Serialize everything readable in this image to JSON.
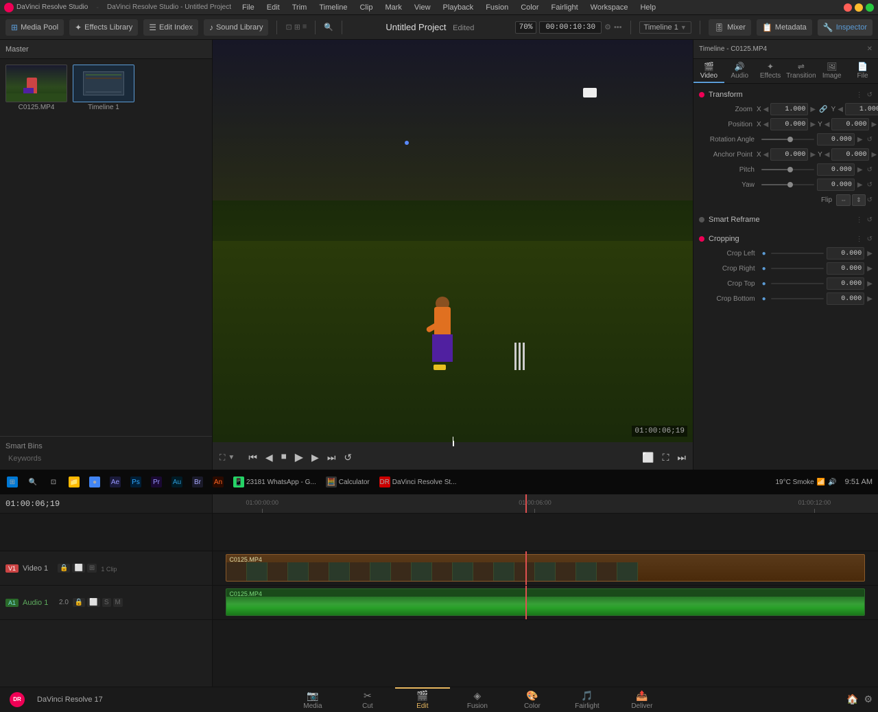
{
  "app": {
    "title": "DaVinci Resolve Studio - Untitled Project",
    "name": "DaVinci Resolve Studio",
    "project_name": "Untitled Project",
    "edited_label": "Edited"
  },
  "menu": {
    "items": [
      "DaVinci Resolve",
      "File",
      "Edit",
      "Trim",
      "Timeline",
      "Clip",
      "Mark",
      "View",
      "Playback",
      "Fusion",
      "Color",
      "Fairlight",
      "Workspace",
      "Help"
    ]
  },
  "toolbar": {
    "media_pool": "Media Pool",
    "effects_library": "Effects Library",
    "edit_index": "Edit Index",
    "sound_library": "Sound Library",
    "project_title": "Untitled Project",
    "edited": "Edited",
    "timeline_label": "Timeline 1",
    "zoom_level": "70%",
    "timecode": "00:00:10:30",
    "mixer": "Mixer",
    "metadata": "Metadata",
    "inspector": "Inspector",
    "timeline_inspector": "Timeline - C0125.MP4"
  },
  "media_panel": {
    "title": "Master",
    "clips": [
      {
        "name": "C0125.MP4",
        "type": "video"
      },
      {
        "name": "Timeline 1",
        "type": "timeline"
      }
    ]
  },
  "smart_bins": {
    "title": "Smart Bins",
    "keywords": "Keywords"
  },
  "preview": {
    "timecode": "01:00:06;19"
  },
  "inspector": {
    "title": "Timeline - C0125.MP4",
    "tabs": [
      "Video",
      "Audio",
      "Effects",
      "Transition",
      "Image",
      "File"
    ],
    "sections": {
      "transform": {
        "label": "Transform",
        "zoom": {
          "x": "1.000",
          "y": "1.000"
        },
        "position": {
          "x": "0.000",
          "y": "0.000"
        },
        "rotation_angle": "0.000",
        "anchor_point": {
          "x": "0.000",
          "y": "0.000"
        },
        "pitch": "0.000",
        "yaw": "0.000"
      },
      "smart_reframe": {
        "label": "Smart Reframe"
      },
      "cropping": {
        "label": "Cropping",
        "crop_left": "0.000",
        "crop_right": "0.000",
        "crop_top": "0.000",
        "crop_bottom": "0.000"
      }
    }
  },
  "timeline": {
    "timecode": "01:00:06;19",
    "tracks": [
      {
        "id": "V1",
        "label": "Video 1",
        "type": "video"
      },
      {
        "id": "A1",
        "label": "Audio 1",
        "type": "audio",
        "level": "2.0"
      }
    ],
    "ruler": {
      "marks": [
        "01:00:00:00",
        "01:00:06:00",
        "01:00:12:00"
      ]
    },
    "clips": [
      {
        "name": "C0125.MP4",
        "track": "video",
        "type": "video"
      },
      {
        "name": "C0125.MP4",
        "track": "audio",
        "type": "audio"
      }
    ]
  },
  "bottom_nav": {
    "tabs": [
      {
        "label": "Media",
        "icon": "📷",
        "active": false
      },
      {
        "label": "Cut",
        "icon": "✂",
        "active": false
      },
      {
        "label": "Edit",
        "icon": "🎬",
        "active": true
      },
      {
        "label": "Fusion",
        "icon": "◈",
        "active": false
      },
      {
        "label": "Color",
        "icon": "🎨",
        "active": false
      },
      {
        "label": "Fairlight",
        "icon": "🎵",
        "active": false
      },
      {
        "label": "Deliver",
        "icon": "📤",
        "active": false
      }
    ],
    "app_name": "DaVinci Resolve 17"
  },
  "taskbar": {
    "time": "9:51 AM",
    "weather": "19°C Smoke",
    "resolve_label": "DaVinci Resolve St...",
    "calculator_label": "Calculator",
    "whatsapp_label": "23181 WhatsApp - G..."
  }
}
